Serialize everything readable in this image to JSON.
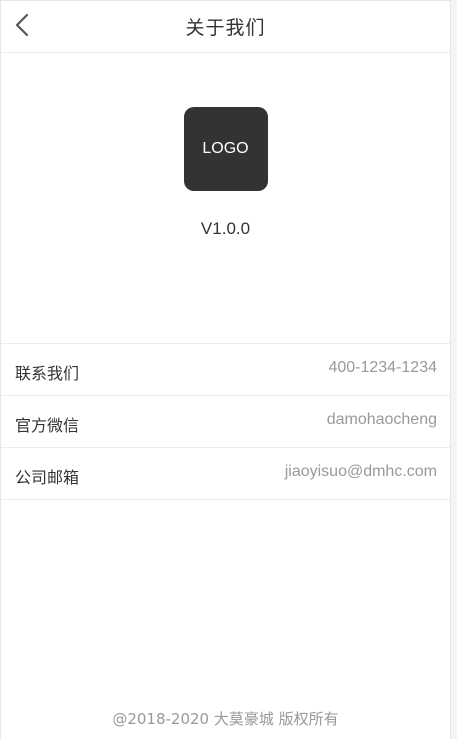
{
  "header": {
    "title": "关于我们",
    "back_icon": "chevron-left-icon"
  },
  "app": {
    "logo_text": "LOGO",
    "version": "V1.0.0"
  },
  "contacts": [
    {
      "label": "联系我们",
      "value": "400-1234-1234"
    },
    {
      "label": "官方微信",
      "value": "damohaocheng"
    },
    {
      "label": "公司邮箱",
      "value": "jiaoyisuo@dmhc.com"
    }
  ],
  "footer": {
    "copyright": "@2018-2020 大莫豪城 版权所有"
  },
  "colors": {
    "logo_background": "#333333",
    "text_primary": "#333333",
    "text_secondary": "#999999",
    "divider": "#ededed"
  }
}
